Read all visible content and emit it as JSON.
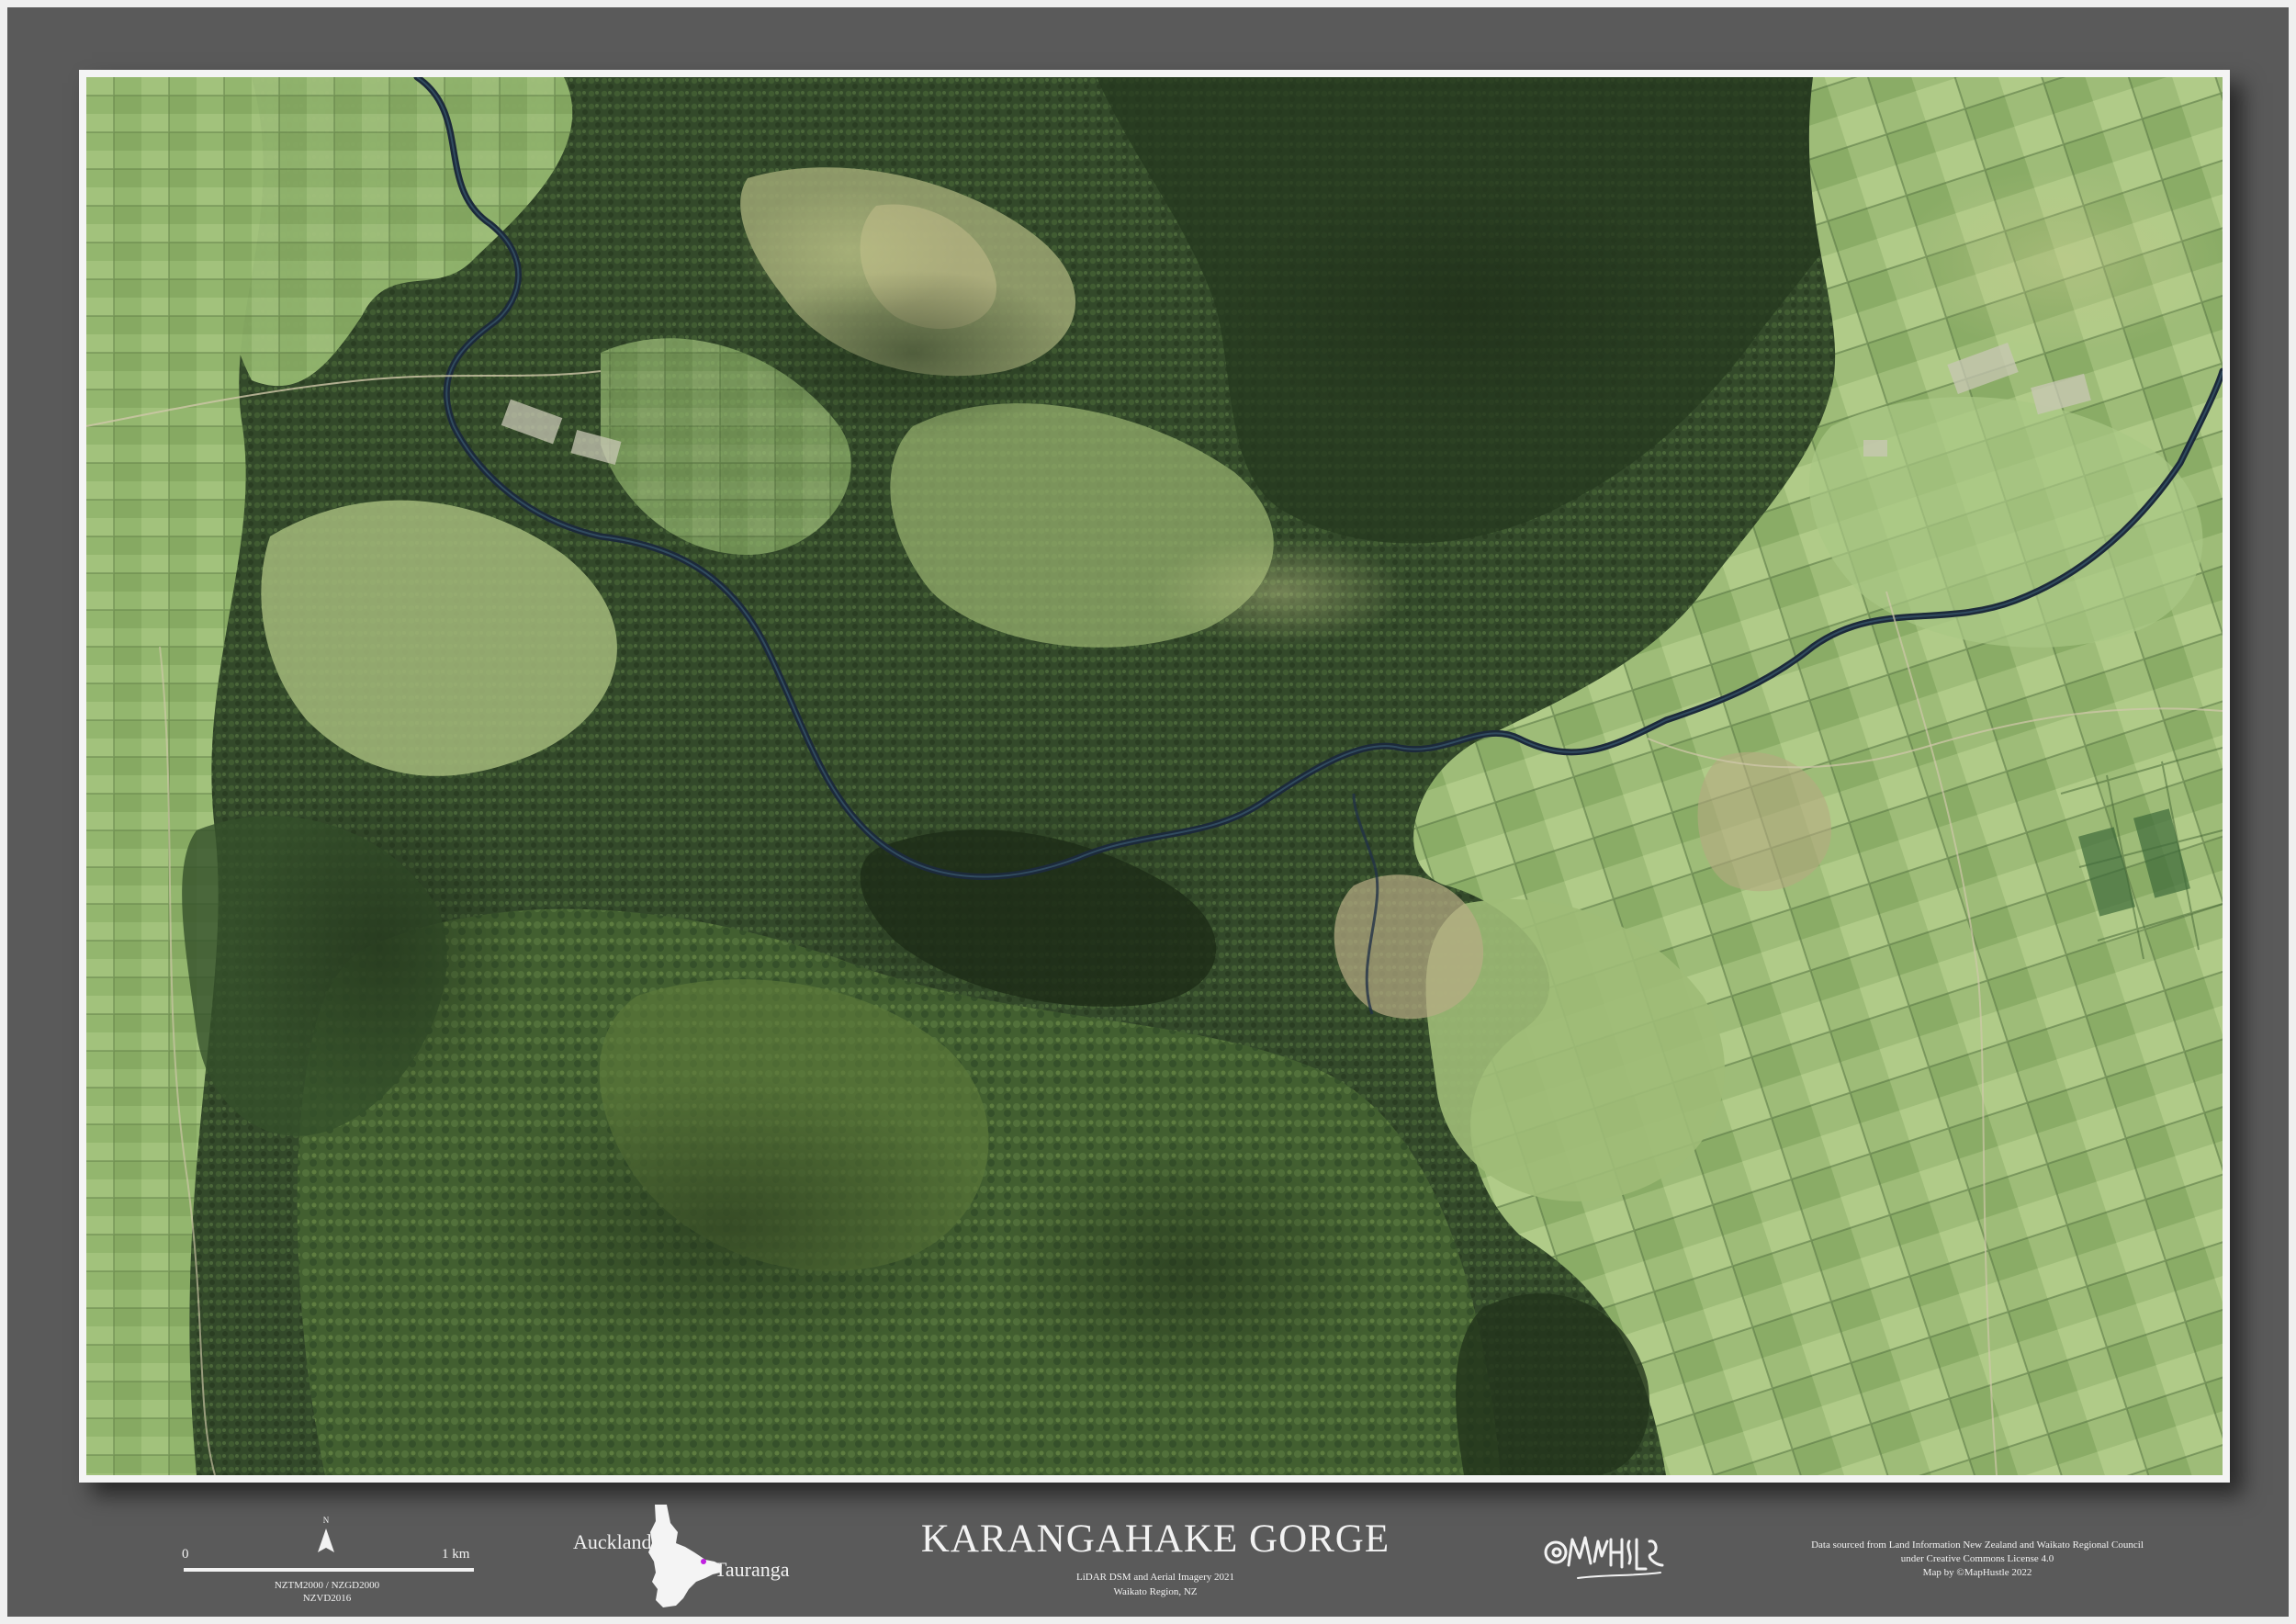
{
  "map": {
    "title": "KARANGAHAKE GORGE",
    "subtitle_line1": "LiDAR DSM and Aerial Imagery 2021",
    "subtitle_line2": "Waikato Region, NZ"
  },
  "scale_bar": {
    "start_label": "0",
    "end_label": "1 km",
    "north_label": "N",
    "crs_line1": "NZTM2000 / NZGD2000",
    "crs_line2": "NZVD2016"
  },
  "inset": {
    "label_left": "Auckland",
    "label_right": "Tauranga",
    "marker_color": "#c020e0"
  },
  "signature": {
    "text": "@MapHstle"
  },
  "credits": {
    "line1": "Data sourced from Land Information New Zealand and Waikato Regional Council",
    "line2": "under Creative Commons License 4.0",
    "line3": "Map by ©MapHustle 2022"
  },
  "colors": {
    "background": "#5a5a5a",
    "frame": "#f4f4f4",
    "forest_dark": "#2c3f22",
    "forest": "#3e5a2e",
    "pasture": "#8fb36a",
    "pasture_light": "#a9c884",
    "river": "#1c2a3a",
    "text": "#f2f2f2"
  }
}
